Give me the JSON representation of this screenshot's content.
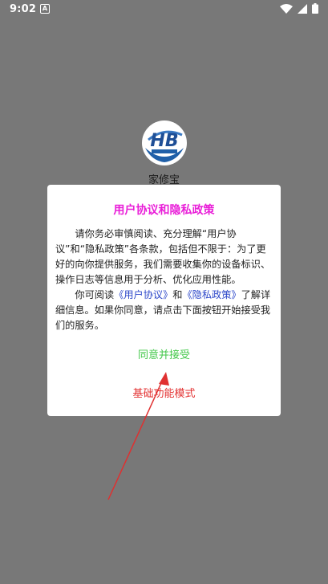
{
  "status_bar": {
    "time": "9:02",
    "notification_icon": "a-letter-icon",
    "right_icons": [
      "wifi-icon",
      "cellular-icon",
      "battery-icon"
    ]
  },
  "app": {
    "name": "家修宝",
    "logo_icon": "hb-logo-icon"
  },
  "dialog": {
    "title": "用户协议和隐私政策",
    "paragraph1": "请你务必审慎阅读、充分理解“用户协议”和“隐私政策”各条款，包括但不限于：为了更好的向你提供服务，我们需要收集你的设备标识、操作日志等信息用于分析、优化应用性能。",
    "paragraph2_prefix": "你可阅读",
    "user_agreement_link": "《用户协议》",
    "and_text": "和",
    "privacy_policy_link": "《隐私政策》",
    "paragraph2_suffix": "了解详细信息。如果你同意，请点击下面按钮开始接受我们的服务。",
    "agree_button": "同意并接受",
    "basic_mode_button": "基础功能模式"
  },
  "colors": {
    "background": "#787878",
    "title": "#e91ed8",
    "link": "#2c47c9",
    "agree": "#43c84a",
    "basic": "#e33232",
    "annotation_arrow": "#e03030"
  }
}
